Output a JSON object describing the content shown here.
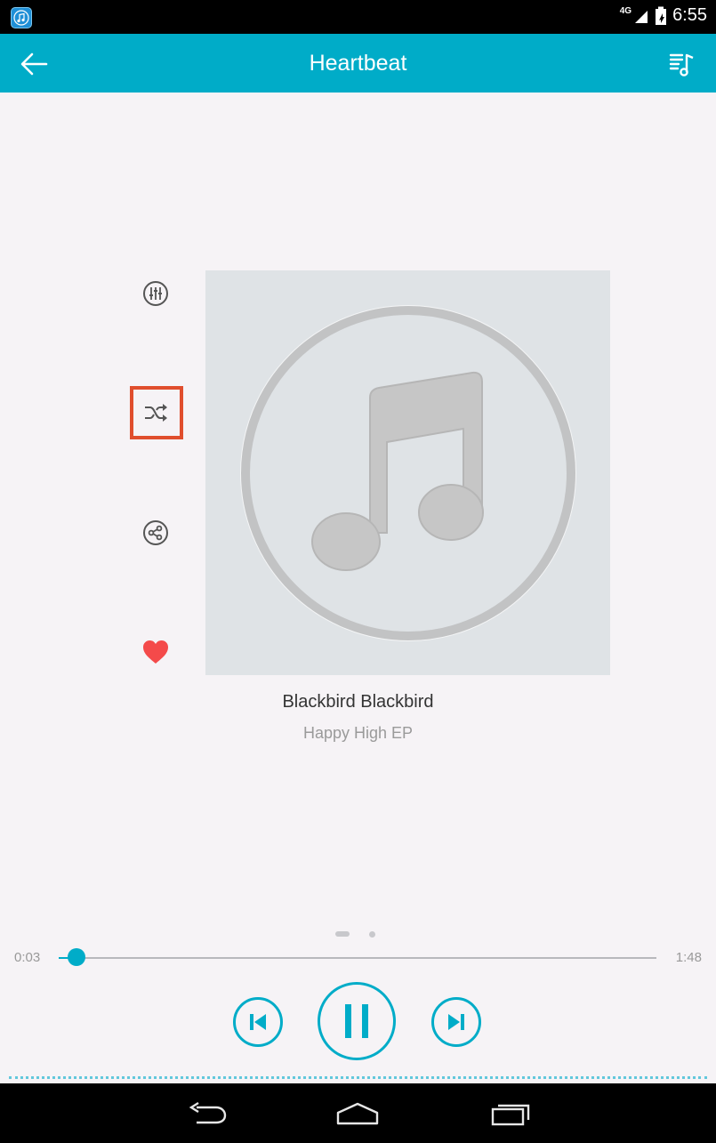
{
  "status_bar": {
    "network": "4G",
    "time": "6:55"
  },
  "app_bar": {
    "title": "Heartbeat"
  },
  "track": {
    "title": "Blackbird Blackbird",
    "album": "Happy High EP"
  },
  "playback": {
    "elapsed": "0:03",
    "total": "1:48",
    "progress_fraction": 0.03,
    "state": "playing"
  },
  "pager": {
    "page_count": 2,
    "active_page": 1
  },
  "side_actions": {
    "equalizer": "equalizer-icon",
    "shuffle": "shuffle-icon",
    "share": "share-icon",
    "favorite": "heart-icon"
  },
  "colors": {
    "accent": "#00acc8",
    "highlight_box": "#e04e2d",
    "favorite": "#f44a4a"
  }
}
